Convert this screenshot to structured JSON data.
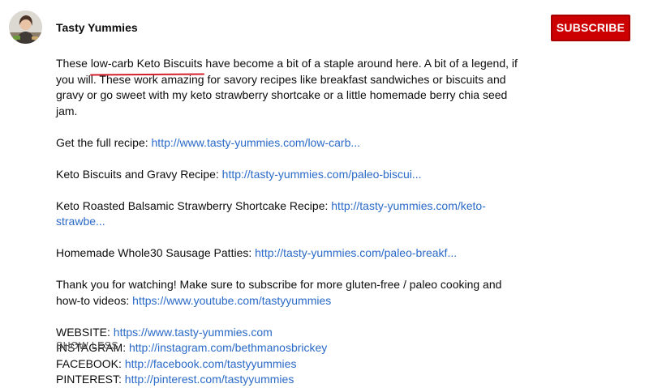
{
  "channel": {
    "name": "Tasty Yummies",
    "subscribe_label": "SUBSCRIBE"
  },
  "colors": {
    "subscribe_bg": "#cc0000",
    "link": "#2a6ac8",
    "highlight_underline": "#d3202a"
  },
  "description": {
    "intro_before": "These ",
    "intro_highlight": "low-carb Keto Biscuits",
    "intro_after": " have become a bit of a staple around here. A bit of a legend, if you will. These work amazing for savory recipes like breakfast sandwiches or biscuits and gravy or go sweet with my keto strawberry shortcake or a little homemade berry chia seed jam.",
    "recipe_lines": [
      {
        "label": "Get the full recipe: ",
        "link": "http://www.tasty-yummies.com/low-carb..."
      },
      {
        "label": "Keto Biscuits and Gravy Recipe: ",
        "link": "http://tasty-yummies.com/paleo-biscui..."
      },
      {
        "label": "Keto Roasted Balsamic Strawberry Shortcake Recipe: ",
        "link": "http://tasty-yummies.com/keto-strawbe..."
      },
      {
        "label": "Homemade Whole30 Sausage Patties: ",
        "link": "http://tasty-yummies.com/paleo-breakf..."
      }
    ],
    "thanks_text": "Thank you for watching! Make sure to subscribe for more gluten-free  / paleo cooking and how-to videos: ",
    "thanks_link": "https://www.youtube.com/tastyyummies",
    "socials": [
      {
        "label": "WEBSITE: ",
        "link": "https://www.tasty-yummies.com"
      },
      {
        "label": "INSTAGRAM: ",
        "link": "http://instagram.com/bethmanosbrickey"
      },
      {
        "label": "FACEBOOK: ",
        "link": "http://facebook.com/tastyyummies"
      },
      {
        "label": "PINTEREST: ",
        "link": "http://pinterest.com/tastyyummies"
      }
    ],
    "show_less_label": "SHOW LESS"
  }
}
